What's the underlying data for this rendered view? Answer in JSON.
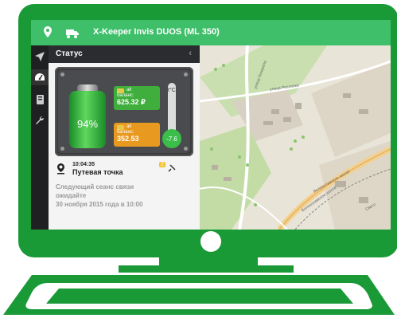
{
  "app": {
    "title": "X-Keeper Invis DUOS (ML 350)"
  },
  "panel": {
    "heading": "Статус",
    "battery_percent_label": "94%",
    "battery_level": 0.94,
    "sim1": {
      "label": "баланс:",
      "value": "625.32 ₽",
      "signal": "all"
    },
    "sim2": {
      "label": "баланс:",
      "value": "352.53",
      "signal": "all"
    },
    "temperature": {
      "unit": "t°C",
      "value": "-7.6"
    },
    "status_time": "10:04:35",
    "status_text": "Путевая точка",
    "status_badge": "2",
    "next_session_line1": "Следующий сеанс связи",
    "next_session_line2": "ожидайте",
    "next_session_line3": "30 ноября 2015 года в 10:00"
  },
  "map": {
    "streets": [
      "улица Генерала",
      "улица Рословка",
      "Волоколамское шоссе",
      "Волоколамское шоссе",
      "Светл"
    ]
  },
  "colors": {
    "frame_green": "#1a9a37",
    "topbar_green": "#3fbf6a",
    "panel_dark": "#2b2c2f"
  },
  "icons": {
    "topbar": [
      "location-pin-icon",
      "truck-icon"
    ],
    "rail": [
      "navigation-arrow-icon",
      "speedometer-icon",
      "book-icon",
      "wrench-icon"
    ]
  }
}
